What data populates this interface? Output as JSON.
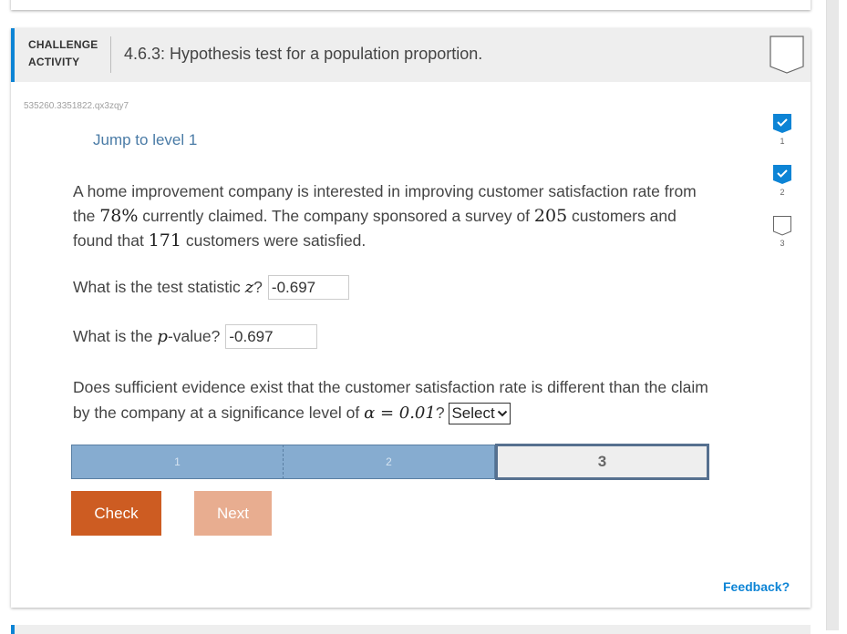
{
  "header": {
    "label_line1": "CHALLENGE",
    "label_line2": "ACTIVITY",
    "title": "4.6.3: Hypothesis test for a population proportion.",
    "badge_icon": "completion-badge-icon"
  },
  "activity_id": "535260.3351822.qx3zqy7",
  "jump_link": "Jump to level 1",
  "problem": {
    "part1": "A home improvement company is interested in improving customer satisfaction rate from the ",
    "claimed_rate": "78%",
    "part2": " currently claimed. The company sponsored a survey of ",
    "survey_size": "205",
    "part3": " customers and found that ",
    "satisfied_count": "171",
    "part4": " customers were satisfied."
  },
  "questions": {
    "q1_prefix": "What is the test statistic ",
    "q1_var": "z",
    "q1_suffix": "?",
    "q1_value": "-0.697",
    "q2_prefix": "What is the ",
    "q2_var": "p",
    "q2_suffix": "-value?",
    "q2_value": "-0.697",
    "q3_text": "Does sufficient evidence exist that the customer satisfaction rate is different than the claim by the company at a significance level of ",
    "q3_alpha": "α = 0.01",
    "q3_qmark": "?",
    "q3_select": "Select"
  },
  "progress": {
    "segments": [
      {
        "label": "1",
        "state": "complete"
      },
      {
        "label": "2",
        "state": "complete"
      },
      {
        "label": "3",
        "state": "current"
      }
    ]
  },
  "buttons": {
    "check": "Check",
    "next": "Next"
  },
  "levels": [
    {
      "label": "1",
      "completed": true
    },
    {
      "label": "2",
      "completed": true
    },
    {
      "label": "3",
      "completed": false
    }
  ],
  "feedback": "Feedback?",
  "colors": {
    "accent_blue": "#0d84d5",
    "check_button": "#cd5c22",
    "next_button": "#e8ad90",
    "progress_complete": "#86acd0"
  }
}
